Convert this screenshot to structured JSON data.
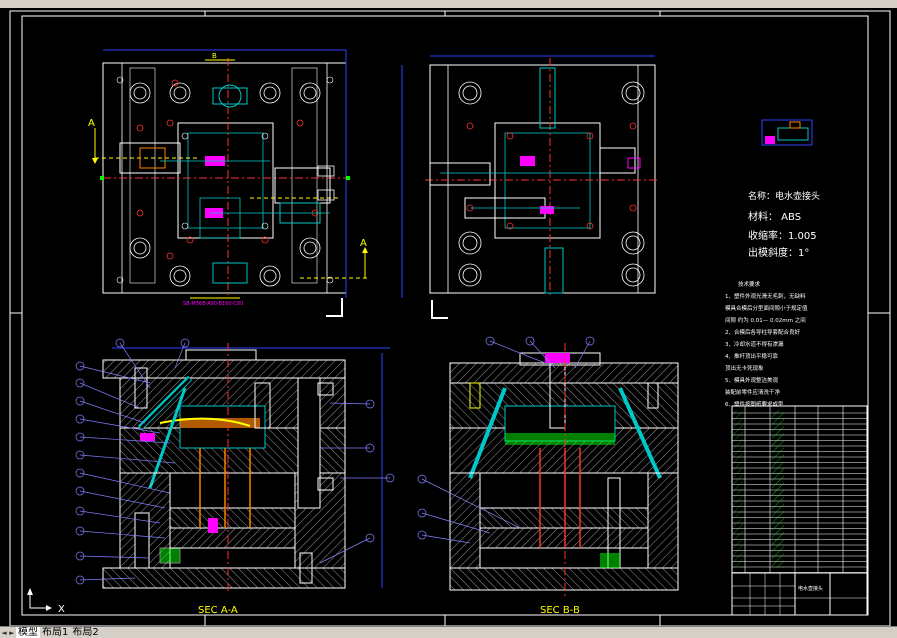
{
  "tabs": {
    "nav_first": "◄",
    "nav_next": "►",
    "model": "模型",
    "layout1": "布局1",
    "layout2": "布局2"
  },
  "drawing": {
    "part_text": "SB-M56B-A90-B160-C80",
    "section_a_label": "SEC   A-A",
    "section_b_label": "SEC   B-B",
    "mark_a": "A",
    "mark_b": "B",
    "ucs_x": "X",
    "spec": {
      "name": "名称：电水壶接头",
      "material": "材料：  ABS",
      "shrink": "收缩率：1.005",
      "draft": "出模斜度：1°"
    },
    "tech_req": [
      "技术要求",
      "1、塑件外观光滑无毛刺，无缺料",
      "模具合模后分型面间隙小于规定值",
      "间隙  约为   0.01— 0.02mm 之间",
      "2、合模后各导柱导套配合良好",
      "3、冷却水道不得有渗漏",
      "4、推杆顶出平稳可靠",
      "顶出无卡死现象",
      "5、模具外观整洁美观",
      "装配前零件应清洗干净",
      "6、塑件按图纸要求成型"
    ],
    "title_block": "电水壶接头"
  },
  "colors": {
    "background": "#000000",
    "line_white": "#ffffff",
    "line_cyan": "#00c8c8",
    "line_red": "#ff3030",
    "line_magenta": "#ff00ff",
    "line_green": "#00ff00",
    "line_blue": "#3040ff",
    "line_yellow": "#ffff00",
    "line_orange": "#ff8000",
    "balloon": "#8080ff"
  }
}
